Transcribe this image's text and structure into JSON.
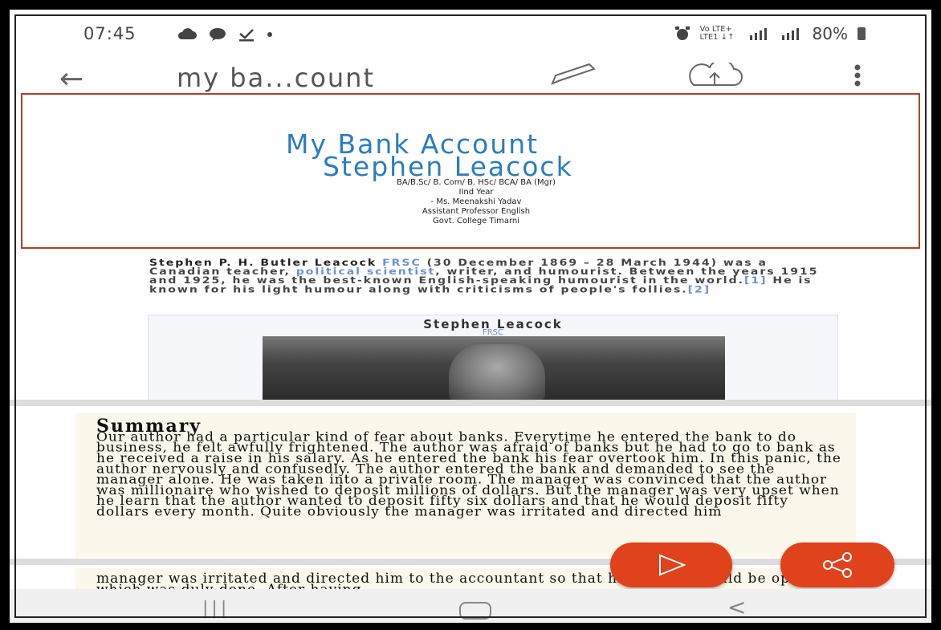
{
  "status": {
    "time": "07:45",
    "network": "Vo LTE+ LTE1 ↓↑",
    "battery": "80%"
  },
  "appbar": {
    "back_icon": "←",
    "title": "my ba...count"
  },
  "slide1": {
    "title_line1": "My Bank Account",
    "title_line2": "Stephen Leacock",
    "subtitle_lines": [
      "BA/B.Sc/ B. Com/ B. HSc/ BCA/ BA (Mgr)",
      "IInd Year",
      "- Ms. Meenakshi Yadav",
      "Assistant Professor English",
      "Govt. College Timarni"
    ]
  },
  "slide2": {
    "bio_bold": "Stephen P. H. Butler Leacock",
    "bio_frsc": "FRSC",
    "bio_part1": " (30 December 1869 – 28 March 1944) was a Canadian teacher, ",
    "bio_link": "political scientist",
    "bio_part2": ", writer, and humourist. Between the years 1915 and 1925, he was the best-known English-speaking humourist in the world.",
    "bio_ref1": "[1]",
    "bio_part3": " He is known for his light humour along with criticisms of people's follies.",
    "bio_ref2": "[2]",
    "info_name": "Stephen Leacock",
    "info_frsc": "FRSC"
  },
  "slide3": {
    "heading": "Summary",
    "body": "Our author had a particular kind of fear about banks. Everytime he entered the bank to do business, he felt awfully frightened. The author was afraid of banks but he had to go to bank as he received a raise in his salary. As he entered the bank his fear overtook him. In this panic, the author nervously and confusedly. The author entered the bank and demanded to see the manager alone. He was taken into a private room. The manager was convinced that the author was millionaire who wished to deposit millions of dollars. But the manager was very upset when he learn that the author wanted to deposit fifty six dollars and that he would deposit fifty dollars every month. Quite obviously the manager was irritated and directed him"
  },
  "slide4": {
    "body": "manager was irritated and directed him to the accountant so that his account could be opened, which was duly done. After having"
  }
}
